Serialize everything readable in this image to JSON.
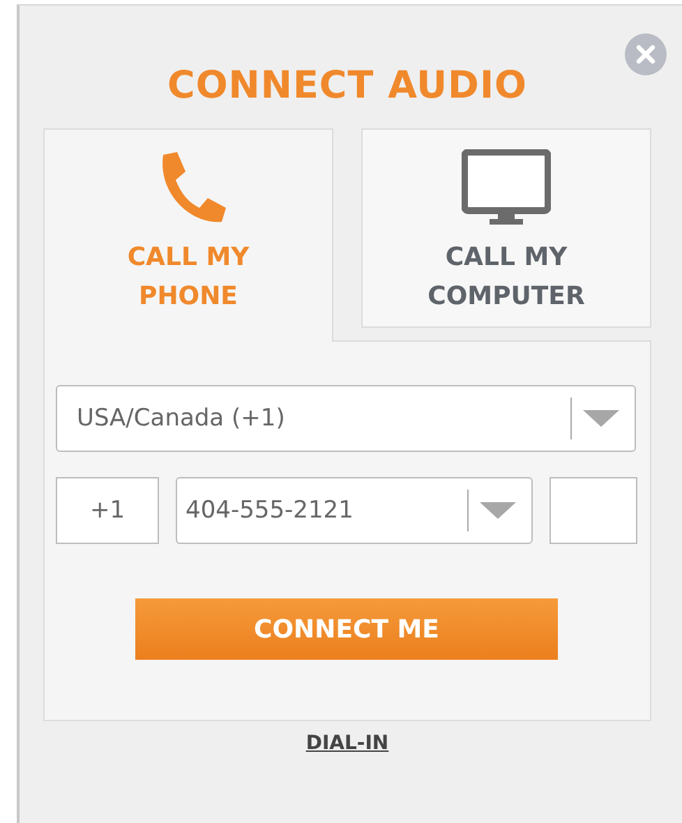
{
  "dialog": {
    "title": "CONNECT AUDIO"
  },
  "tabs": [
    {
      "label": "CALL MY\nPHONE",
      "kind": "phone",
      "selected": true
    },
    {
      "label": "CALL MY\nCOMPUTER",
      "kind": "computer",
      "selected": false
    }
  ],
  "country_select": {
    "value": "USA/Canada (+1)"
  },
  "country_code": {
    "value": "+1"
  },
  "phone_number": {
    "value": "404-555-2121"
  },
  "connect_button": "CONNECT ME",
  "dial_in_link": "DIAL-IN"
}
